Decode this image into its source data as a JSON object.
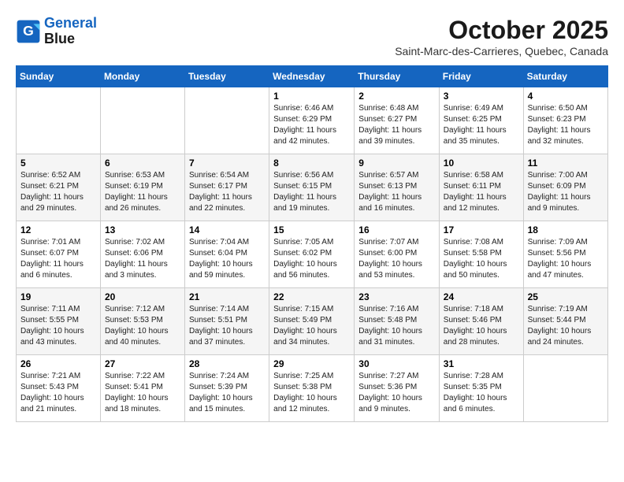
{
  "header": {
    "logo_line1": "General",
    "logo_line2": "Blue",
    "month": "October 2025",
    "location": "Saint-Marc-des-Carrieres, Quebec, Canada"
  },
  "weekdays": [
    "Sunday",
    "Monday",
    "Tuesday",
    "Wednesday",
    "Thursday",
    "Friday",
    "Saturday"
  ],
  "weeks": [
    [
      {
        "day": "",
        "data": ""
      },
      {
        "day": "",
        "data": ""
      },
      {
        "day": "",
        "data": ""
      },
      {
        "day": "1",
        "data": "Sunrise: 6:46 AM\nSunset: 6:29 PM\nDaylight: 11 hours and 42 minutes."
      },
      {
        "day": "2",
        "data": "Sunrise: 6:48 AM\nSunset: 6:27 PM\nDaylight: 11 hours and 39 minutes."
      },
      {
        "day": "3",
        "data": "Sunrise: 6:49 AM\nSunset: 6:25 PM\nDaylight: 11 hours and 35 minutes."
      },
      {
        "day": "4",
        "data": "Sunrise: 6:50 AM\nSunset: 6:23 PM\nDaylight: 11 hours and 32 minutes."
      }
    ],
    [
      {
        "day": "5",
        "data": "Sunrise: 6:52 AM\nSunset: 6:21 PM\nDaylight: 11 hours and 29 minutes."
      },
      {
        "day": "6",
        "data": "Sunrise: 6:53 AM\nSunset: 6:19 PM\nDaylight: 11 hours and 26 minutes."
      },
      {
        "day": "7",
        "data": "Sunrise: 6:54 AM\nSunset: 6:17 PM\nDaylight: 11 hours and 22 minutes."
      },
      {
        "day": "8",
        "data": "Sunrise: 6:56 AM\nSunset: 6:15 PM\nDaylight: 11 hours and 19 minutes."
      },
      {
        "day": "9",
        "data": "Sunrise: 6:57 AM\nSunset: 6:13 PM\nDaylight: 11 hours and 16 minutes."
      },
      {
        "day": "10",
        "data": "Sunrise: 6:58 AM\nSunset: 6:11 PM\nDaylight: 11 hours and 12 minutes."
      },
      {
        "day": "11",
        "data": "Sunrise: 7:00 AM\nSunset: 6:09 PM\nDaylight: 11 hours and 9 minutes."
      }
    ],
    [
      {
        "day": "12",
        "data": "Sunrise: 7:01 AM\nSunset: 6:07 PM\nDaylight: 11 hours and 6 minutes."
      },
      {
        "day": "13",
        "data": "Sunrise: 7:02 AM\nSunset: 6:06 PM\nDaylight: 11 hours and 3 minutes."
      },
      {
        "day": "14",
        "data": "Sunrise: 7:04 AM\nSunset: 6:04 PM\nDaylight: 10 hours and 59 minutes."
      },
      {
        "day": "15",
        "data": "Sunrise: 7:05 AM\nSunset: 6:02 PM\nDaylight: 10 hours and 56 minutes."
      },
      {
        "day": "16",
        "data": "Sunrise: 7:07 AM\nSunset: 6:00 PM\nDaylight: 10 hours and 53 minutes."
      },
      {
        "day": "17",
        "data": "Sunrise: 7:08 AM\nSunset: 5:58 PM\nDaylight: 10 hours and 50 minutes."
      },
      {
        "day": "18",
        "data": "Sunrise: 7:09 AM\nSunset: 5:56 PM\nDaylight: 10 hours and 47 minutes."
      }
    ],
    [
      {
        "day": "19",
        "data": "Sunrise: 7:11 AM\nSunset: 5:55 PM\nDaylight: 10 hours and 43 minutes."
      },
      {
        "day": "20",
        "data": "Sunrise: 7:12 AM\nSunset: 5:53 PM\nDaylight: 10 hours and 40 minutes."
      },
      {
        "day": "21",
        "data": "Sunrise: 7:14 AM\nSunset: 5:51 PM\nDaylight: 10 hours and 37 minutes."
      },
      {
        "day": "22",
        "data": "Sunrise: 7:15 AM\nSunset: 5:49 PM\nDaylight: 10 hours and 34 minutes."
      },
      {
        "day": "23",
        "data": "Sunrise: 7:16 AM\nSunset: 5:48 PM\nDaylight: 10 hours and 31 minutes."
      },
      {
        "day": "24",
        "data": "Sunrise: 7:18 AM\nSunset: 5:46 PM\nDaylight: 10 hours and 28 minutes."
      },
      {
        "day": "25",
        "data": "Sunrise: 7:19 AM\nSunset: 5:44 PM\nDaylight: 10 hours and 24 minutes."
      }
    ],
    [
      {
        "day": "26",
        "data": "Sunrise: 7:21 AM\nSunset: 5:43 PM\nDaylight: 10 hours and 21 minutes."
      },
      {
        "day": "27",
        "data": "Sunrise: 7:22 AM\nSunset: 5:41 PM\nDaylight: 10 hours and 18 minutes."
      },
      {
        "day": "28",
        "data": "Sunrise: 7:24 AM\nSunset: 5:39 PM\nDaylight: 10 hours and 15 minutes."
      },
      {
        "day": "29",
        "data": "Sunrise: 7:25 AM\nSunset: 5:38 PM\nDaylight: 10 hours and 12 minutes."
      },
      {
        "day": "30",
        "data": "Sunrise: 7:27 AM\nSunset: 5:36 PM\nDaylight: 10 hours and 9 minutes."
      },
      {
        "day": "31",
        "data": "Sunrise: 7:28 AM\nSunset: 5:35 PM\nDaylight: 10 hours and 6 minutes."
      },
      {
        "day": "",
        "data": ""
      }
    ]
  ]
}
